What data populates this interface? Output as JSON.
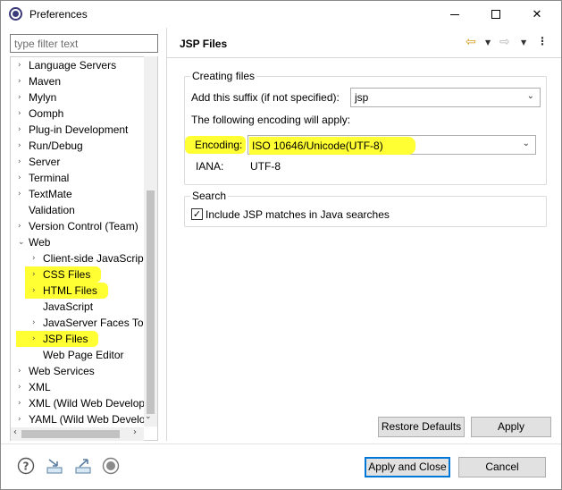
{
  "window": {
    "title": "Preferences",
    "minimize_glyph": "",
    "close_glyph": "✕"
  },
  "filter": {
    "placeholder": "type filter text"
  },
  "tree": {
    "items": [
      {
        "label": "Language Servers",
        "chevron": "›"
      },
      {
        "label": "Maven",
        "chevron": "›"
      },
      {
        "label": "Mylyn",
        "chevron": "›"
      },
      {
        "label": "Oomph",
        "chevron": "›"
      },
      {
        "label": "Plug-in Development",
        "chevron": "›"
      },
      {
        "label": "Run/Debug",
        "chevron": "›"
      },
      {
        "label": "Server",
        "chevron": "›"
      },
      {
        "label": "Terminal",
        "chevron": "›"
      },
      {
        "label": "TextMate",
        "chevron": "›"
      },
      {
        "label": "Validation",
        "chevron": ""
      },
      {
        "label": "Version Control (Team)",
        "chevron": "›"
      },
      {
        "label": "Web",
        "chevron": "⌄"
      },
      {
        "label": "Client-side JavaScript",
        "chevron": "›"
      },
      {
        "label": "CSS Files",
        "chevron": "›"
      },
      {
        "label": "HTML Files",
        "chevron": "›"
      },
      {
        "label": "JavaScript",
        "chevron": ""
      },
      {
        "label": "JavaServer Faces Tools",
        "chevron": "›"
      },
      {
        "label": "JSP Files",
        "chevron": "›"
      },
      {
        "label": "Web Page Editor",
        "chevron": ""
      },
      {
        "label": "Web Services",
        "chevron": "›"
      },
      {
        "label": "XML",
        "chevron": "›"
      },
      {
        "label": "XML (Wild Web Developer)",
        "chevron": "›"
      },
      {
        "label": "YAML (Wild Web Developer)",
        "chevron": "›"
      }
    ],
    "scroll_down_glyph": "⌄",
    "scroll_left_glyph": "‹",
    "scroll_right_glyph": "›"
  },
  "page": {
    "title": "JSP Files",
    "nav_back_glyph": "⇦",
    "nav_fwd_glyph": "⇨",
    "nav_drop_glyph": "▼",
    "nav_menu_glyph": "⋮"
  },
  "creating_files": {
    "group_title": "Creating files",
    "suffix_label": "Add this suffix (if not specified):",
    "suffix_value": "jsp",
    "encoding_note": "The following encoding will apply:",
    "encoding_label": "Encoding:",
    "encoding_value": "ISO 10646/Unicode(UTF-8)",
    "iana_label": "IANA:",
    "iana_value": "UTF-8",
    "combo_arrow": "⌄"
  },
  "search": {
    "group_title": "Search",
    "checkbox_label": "Include JSP matches in Java searches",
    "checked": true,
    "check_glyph": "✓"
  },
  "buttons": {
    "restore_defaults": "Restore Defaults",
    "apply": "Apply",
    "apply_and_close": "Apply and Close",
    "cancel": "Cancel"
  },
  "bottom_icons": [
    "help-icon",
    "import-icon",
    "export-icon",
    "record-icon"
  ],
  "colors": {
    "highlight": "#ffff33",
    "accent": "#0078d7",
    "nav_back": "#d09a16"
  }
}
